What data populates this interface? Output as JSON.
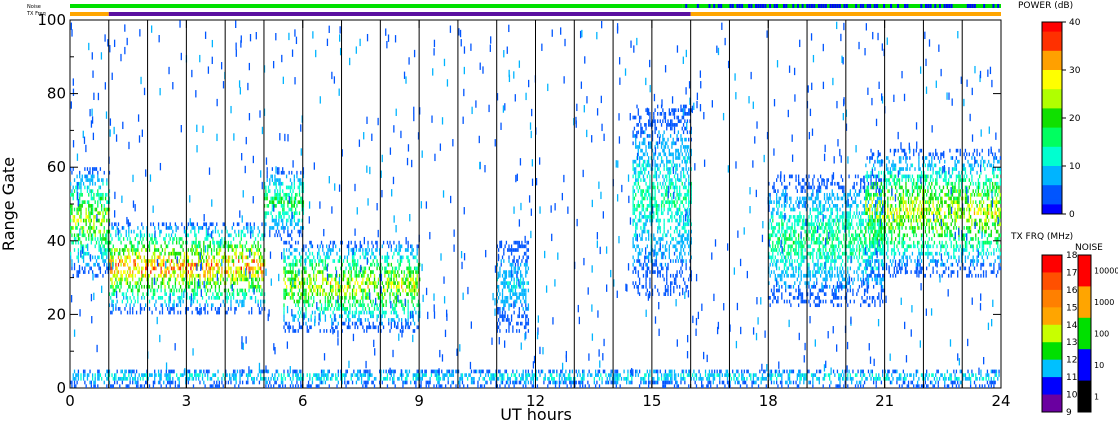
{
  "chart_data": {
    "type": "heatmap",
    "xlabel": "UT hours",
    "ylabel": "Range Gate",
    "x_ticks": [
      "0",
      "3",
      "6",
      "9",
      "12",
      "15",
      "18",
      "21",
      "24"
    ],
    "y_ticks": [
      "0",
      "20",
      "40",
      "60",
      "80",
      "100"
    ],
    "xlim": [
      0,
      24
    ],
    "ylim": [
      0,
      100
    ],
    "grid": "vertical lines every 1 hour",
    "strip_labels": {
      "noise": "Noise",
      "txfreq": "TX Freq"
    },
    "noise_strip": [
      {
        "from": 0,
        "to": 15.8,
        "level": "100"
      },
      {
        "from": 15.8,
        "to": 24,
        "level": "100 / 10 mixed"
      }
    ],
    "txfreq_strip": [
      {
        "from": 0,
        "to": 1.0,
        "mhz": 15
      },
      {
        "from": 1.0,
        "to": 16.0,
        "mhz": 11
      },
      {
        "from": 16.0,
        "to": 24,
        "mhz": 15
      }
    ],
    "echo_regions": [
      {
        "from": 0.0,
        "to": 1.0,
        "gate_min": 30,
        "gate_max": 60,
        "peak_db": 28
      },
      {
        "from": 1.0,
        "to": 5.0,
        "gate_min": 20,
        "gate_max": 45,
        "peak_db": 38
      },
      {
        "from": 5.0,
        "to": 6.0,
        "gate_min": 40,
        "gate_max": 60,
        "peak_db": 20
      },
      {
        "from": 5.5,
        "to": 9.0,
        "gate_min": 15,
        "gate_max": 40,
        "peak_db": 30
      },
      {
        "from": 11.0,
        "to": 11.8,
        "gate_min": 15,
        "gate_max": 40,
        "peak_db": 10
      },
      {
        "from": 14.5,
        "to": 16.0,
        "gate_min": 25,
        "gate_max": 77,
        "peak_db": 15
      },
      {
        "from": 18.0,
        "to": 21.0,
        "gate_min": 22,
        "gate_max": 58,
        "peak_db": 18
      },
      {
        "from": 20.5,
        "to": 24.0,
        "gate_min": 30,
        "gate_max": 65,
        "peak_db": 30
      },
      {
        "from": 0.0,
        "to": 24.0,
        "gate_min": 0,
        "gate_max": 5,
        "peak_db": 12
      }
    ],
    "power_colorbar": {
      "label": "POWER (dB)",
      "ticks": [
        "40",
        "30",
        "20",
        "10",
        "0"
      ],
      "range": [
        0,
        40
      ]
    },
    "txfrq_colorbar": {
      "label": "TX FRQ (MHz)",
      "ticks": [
        "18",
        "17",
        "16",
        "15",
        "14",
        "13",
        "12",
        "11",
        "10",
        "9"
      ]
    },
    "noise_colorbar": {
      "label": "NOISE",
      "ticks": [
        "10000",
        "1000",
        "100",
        "10",
        "1"
      ]
    }
  },
  "palette": {
    "power": [
      "#0000ff",
      "#0055ff",
      "#00b4ff",
      "#00ffd0",
      "#00ff60",
      "#10e000",
      "#b0ff00",
      "#ffff00",
      "#ffa000",
      "#ff3000",
      "#ff0000"
    ],
    "txfreq_scale": [
      "#ff0000",
      "#ff5000",
      "#ff8000",
      "#ffa500",
      "#c8ff00",
      "#00e000",
      "#00c0ff",
      "#0000ff",
      "#6a00a0",
      "#000000"
    ],
    "noise_scale": [
      "#ff0000",
      "#ffa500",
      "#00e000",
      "#0000ff",
      "#000000"
    ],
    "strip_orange": "#ffa500",
    "strip_purple": "#5a0fa0",
    "strip_green": "#00e000",
    "strip_blue": "#0000ff"
  }
}
